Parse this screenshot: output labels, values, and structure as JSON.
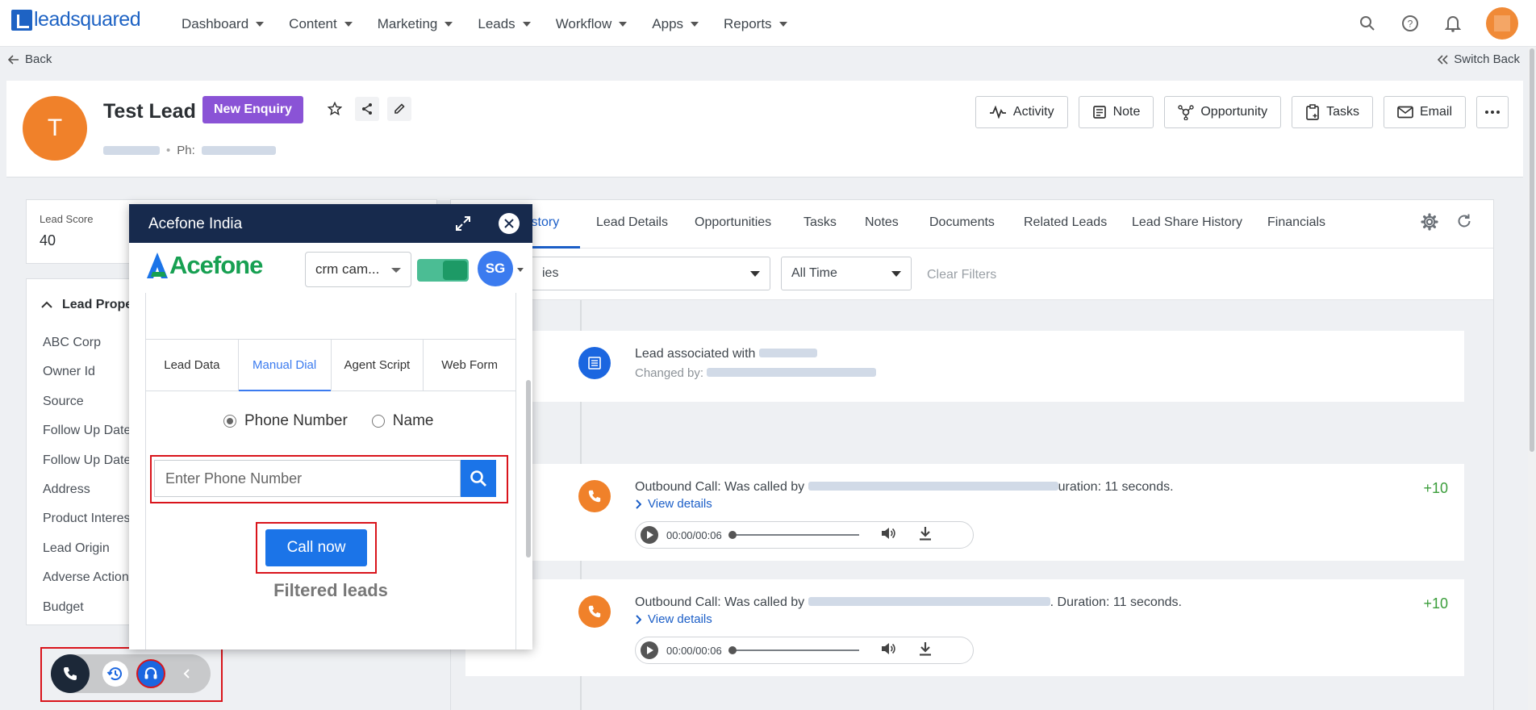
{
  "app": {
    "logo": "leadsquared"
  },
  "nav": {
    "items": [
      "Dashboard",
      "Content",
      "Marketing",
      "Leads",
      "Workflow",
      "Apps",
      "Reports"
    ]
  },
  "subbar": {
    "back": "Back",
    "switch_back": "Switch Back"
  },
  "lead": {
    "initial": "T",
    "name": "Test Lead",
    "stage": "New Enquiry",
    "phone_label": "Ph:",
    "actions": [
      "Activity",
      "Note",
      "Opportunity",
      "Tasks",
      "Email"
    ]
  },
  "score": {
    "label": "Lead Score",
    "value": "40"
  },
  "properties": {
    "title": "Lead Prope",
    "items": [
      "ABC Corp",
      "Owner Id",
      "Source",
      "Follow Up Date",
      "Follow Up Date",
      "Address",
      "Product Interes",
      "Lead Origin",
      "Adverse Action",
      "Budget"
    ]
  },
  "tabs": {
    "items": [
      "istory",
      "Lead Details",
      "Opportunities",
      "Tasks",
      "Notes",
      "Documents",
      "Related Leads",
      "Lead Share History",
      "Financials"
    ],
    "active": "istory"
  },
  "filters": {
    "activity": "ies",
    "time": "All Time",
    "clear": "Clear Filters"
  },
  "activities": [
    {
      "title": "Lead associated with",
      "sub": "Changed by:"
    },
    {
      "title_a": "Outbound Call: Was called by",
      "title_b": "uration: 11 seconds.",
      "link": "View details",
      "score": "+10",
      "time": "00:00/00:06"
    },
    {
      "title_a": "Outbound Call: Was called by",
      "title_b": ". Duration: 11 seconds.",
      "link": "View details",
      "score": "+10",
      "time": "00:00/00:06"
    }
  ],
  "widget": {
    "title": "Acefone India",
    "logo": "Acefone",
    "campaign": "crm cam...",
    "agent_initials": "SG",
    "tabs": [
      "Lead Data",
      "Manual Dial",
      "Agent Script",
      "Web Form"
    ],
    "active_tab": "Manual Dial",
    "radio_phone": "Phone Number",
    "radio_name": "Name",
    "phone_placeholder": "Enter Phone Number",
    "call_button": "Call now",
    "filtered": "Filtered leads"
  },
  "colors": {
    "brand": "#1e63c4",
    "stage": "#8a53d6",
    "widget_header": "#172a4d",
    "acefone_green": "#17a052",
    "call_blue": "#1b74e8",
    "highlight": "#d9141b"
  }
}
